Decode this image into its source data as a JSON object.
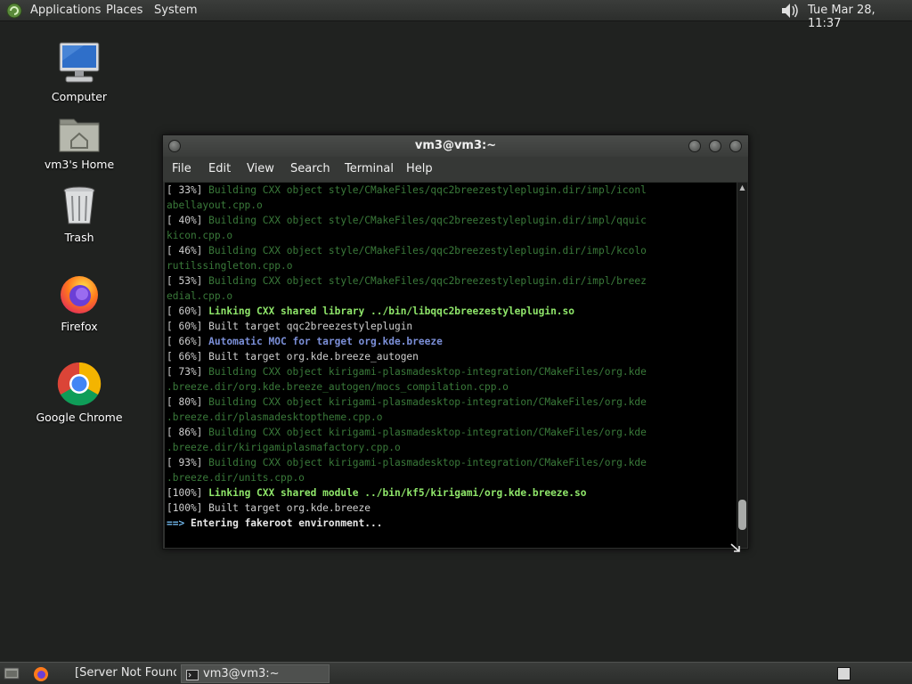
{
  "top_panel": {
    "applications": "Applications",
    "places": "Places",
    "system": "System",
    "clock": "Tue Mar 28, 11:37"
  },
  "desktop": {
    "icons": [
      {
        "label": "Computer",
        "icon": "computer-icon"
      },
      {
        "label": "vm3's Home",
        "icon": "home-folder-icon"
      },
      {
        "label": "Trash",
        "icon": "trash-icon"
      },
      {
        "label": "Firefox",
        "icon": "firefox-icon"
      },
      {
        "label": "Google Chrome",
        "icon": "chrome-icon"
      }
    ]
  },
  "terminal": {
    "title": "vm3@vm3:~",
    "menu": [
      "File",
      "Edit",
      "View",
      "Search",
      "Terminal",
      "Help"
    ],
    "lines": [
      {
        "prefix": "[ 33%] ",
        "text": "Building CXX object style/CMakeFiles/qqc2breezestyleplugin.dir/impl/iconl",
        "style": "build"
      },
      {
        "prefix": "",
        "text": "abellayout.cpp.o",
        "style": "build"
      },
      {
        "prefix": "[ 40%] ",
        "text": "Building CXX object style/CMakeFiles/qqc2breezestyleplugin.dir/impl/qquic",
        "style": "build"
      },
      {
        "prefix": "",
        "text": "kicon.cpp.o",
        "style": "build"
      },
      {
        "prefix": "[ 46%] ",
        "text": "Building CXX object style/CMakeFiles/qqc2breezestyleplugin.dir/impl/kcolo",
        "style": "build"
      },
      {
        "prefix": "",
        "text": "rutilssingleton.cpp.o",
        "style": "build"
      },
      {
        "prefix": "[ 53%] ",
        "text": "Building CXX object style/CMakeFiles/qqc2breezestyleplugin.dir/impl/breez",
        "style": "build"
      },
      {
        "prefix": "",
        "text": "edial.cpp.o",
        "style": "build"
      },
      {
        "prefix": "[ 60%] ",
        "text": "Linking CXX shared library ../bin/libqqc2breezestyleplugin.so",
        "style": "link"
      },
      {
        "prefix": "[ 60%] ",
        "text": "Built target qqc2breezestyleplugin",
        "style": "plain"
      },
      {
        "prefix": "[ 66%] ",
        "text": "Automatic MOC for target org.kde.breeze",
        "style": "moc"
      },
      {
        "prefix": "[ 66%] ",
        "text": "Built target org.kde.breeze_autogen",
        "style": "plain"
      },
      {
        "prefix": "[ 73%] ",
        "text": "Building CXX object kirigami-plasmadesktop-integration/CMakeFiles/org.kde",
        "style": "build"
      },
      {
        "prefix": "",
        "text": ".breeze.dir/org.kde.breeze_autogen/mocs_compilation.cpp.o",
        "style": "build"
      },
      {
        "prefix": "[ 80%] ",
        "text": "Building CXX object kirigami-plasmadesktop-integration/CMakeFiles/org.kde",
        "style": "build"
      },
      {
        "prefix": "",
        "text": ".breeze.dir/plasmadesktoptheme.cpp.o",
        "style": "build"
      },
      {
        "prefix": "[ 86%] ",
        "text": "Building CXX object kirigami-plasmadesktop-integration/CMakeFiles/org.kde",
        "style": "build"
      },
      {
        "prefix": "",
        "text": ".breeze.dir/kirigamiplasmafactory.cpp.o",
        "style": "build"
      },
      {
        "prefix": "[ 93%] ",
        "text": "Building CXX object kirigami-plasmadesktop-integration/CMakeFiles/org.kde",
        "style": "build"
      },
      {
        "prefix": "",
        "text": ".breeze.dir/units.cpp.o",
        "style": "build"
      },
      {
        "prefix": "[100%] ",
        "text": "Linking CXX shared module ../bin/kf5/kirigami/org.kde.breeze.so",
        "style": "link"
      },
      {
        "prefix": "[100%] ",
        "text": "Built target org.kde.breeze",
        "style": "plain"
      },
      {
        "prefix": "==> ",
        "text": "Entering fakeroot environment...",
        "style": "arrow"
      }
    ]
  },
  "taskbar": {
    "tasks": [
      {
        "label": "[Server Not Found ...",
        "icon": "firefox-icon"
      },
      {
        "label": "vm3@vm3:~",
        "icon": "terminal-icon"
      }
    ]
  }
}
